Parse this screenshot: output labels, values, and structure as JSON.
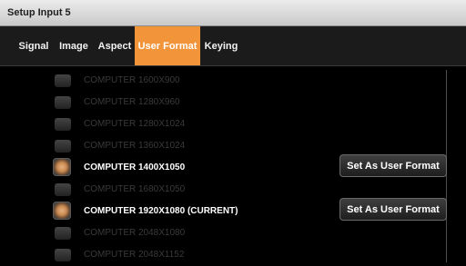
{
  "window": {
    "title": "Setup Input 5"
  },
  "tabs": [
    {
      "label": "Signal"
    },
    {
      "label": "Image"
    },
    {
      "label": "Aspect"
    },
    {
      "label": "User Format"
    },
    {
      "label": "Keying"
    }
  ],
  "active_tab": "User Format",
  "formats": [
    {
      "label": "COMPUTER 1600X900",
      "selected": false,
      "enabled": false
    },
    {
      "label": "COMPUTER 1280X960",
      "selected": false,
      "enabled": false
    },
    {
      "label": "COMPUTER 1280X1024",
      "selected": false,
      "enabled": false
    },
    {
      "label": "COMPUTER 1360X1024",
      "selected": false,
      "enabled": false
    },
    {
      "label": "COMPUTER 1400X1050",
      "selected": true,
      "enabled": true,
      "button": "Set As User Format"
    },
    {
      "label": "COMPUTER 1680X1050",
      "selected": false,
      "enabled": false
    },
    {
      "label": "COMPUTER 1920X1080  (CURRENT)",
      "selected": true,
      "enabled": true,
      "button": "Set As User Format"
    },
    {
      "label": "COMPUTER 2048X1080",
      "selected": false,
      "enabled": false
    },
    {
      "label": "COMPUTER 2048X1152",
      "selected": false,
      "enabled": false
    }
  ],
  "colors": {
    "accent": "#f2953a",
    "background": "#000000",
    "dim_text": "#3a3a3a"
  }
}
